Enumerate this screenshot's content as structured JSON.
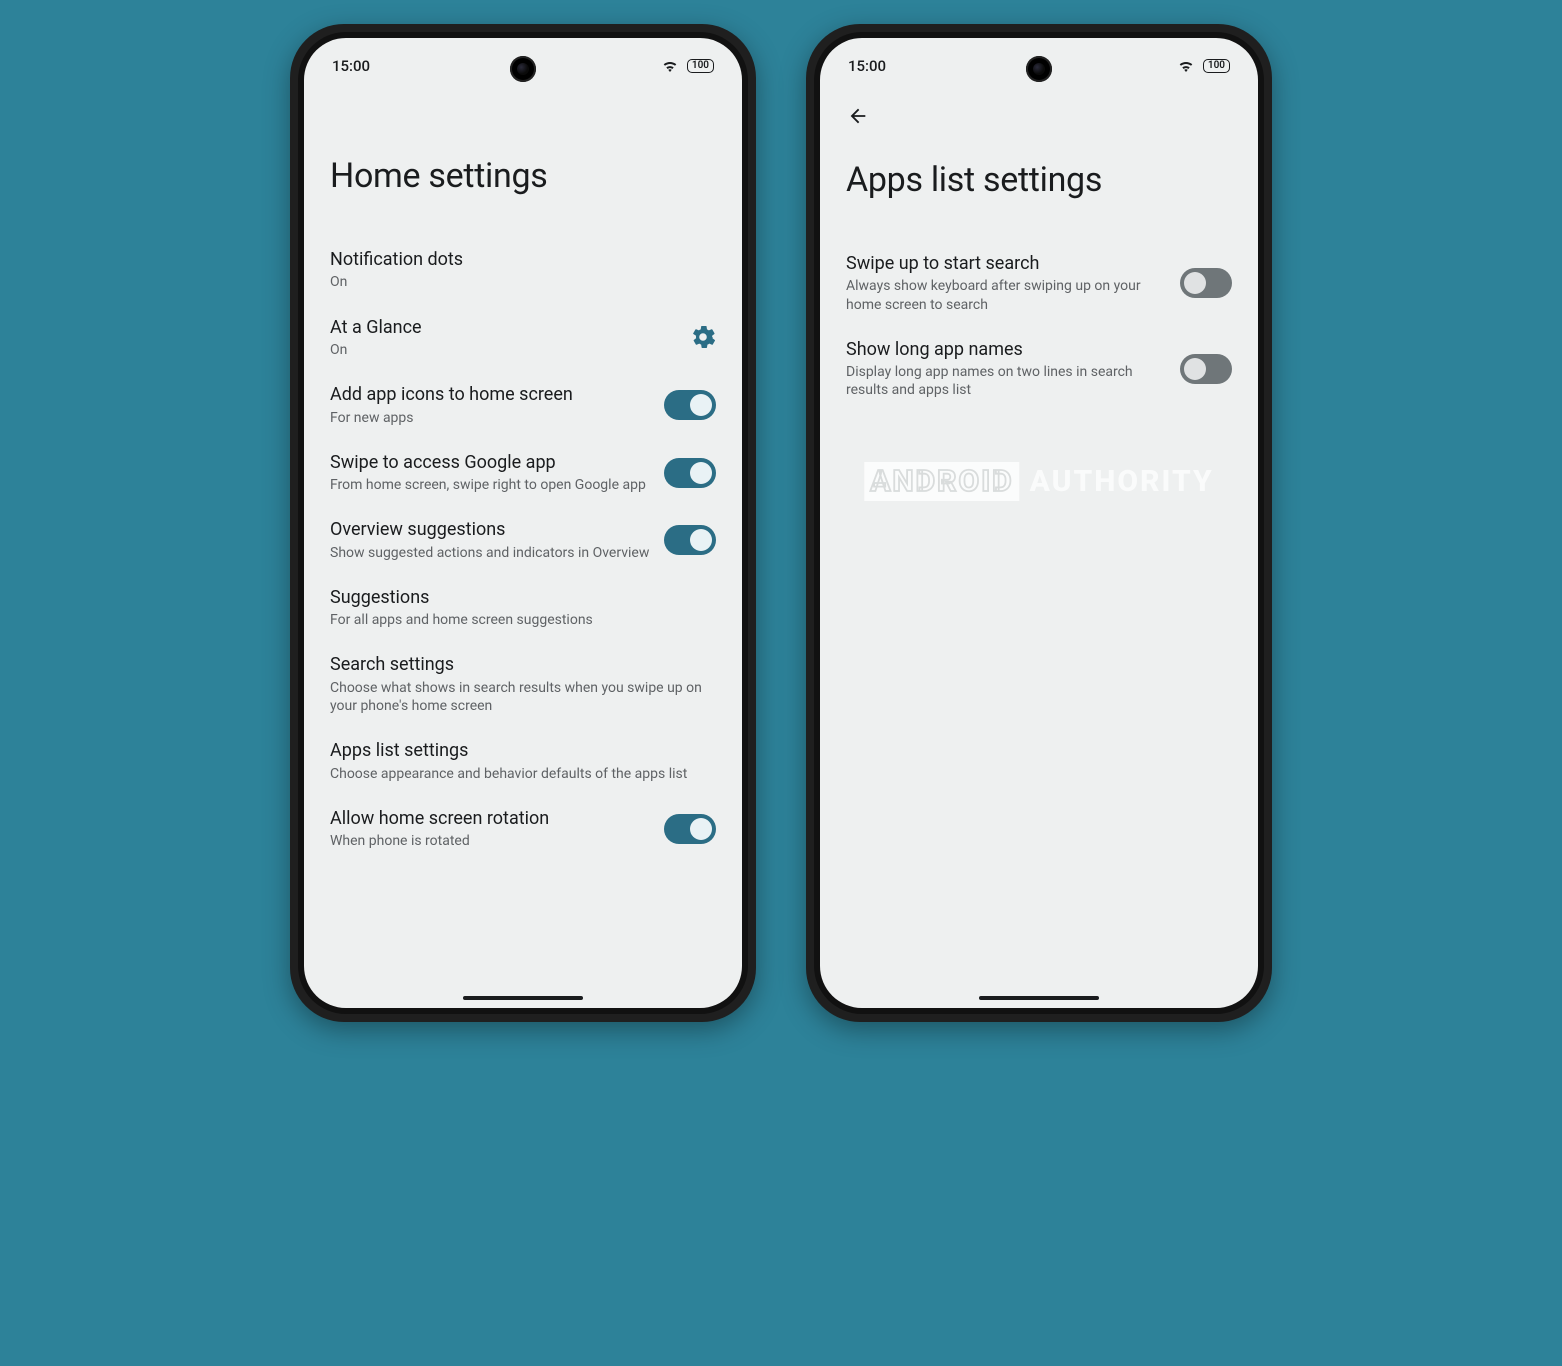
{
  "status": {
    "time": "15:00",
    "battery": "100"
  },
  "left": {
    "title": "Home settings",
    "items": [
      {
        "title": "Notification dots",
        "sub": "On",
        "control": "none"
      },
      {
        "title": "At a Glance",
        "sub": "On",
        "control": "gear"
      },
      {
        "title": "Add app icons to home screen",
        "sub": "For new apps",
        "control": "toggle_on"
      },
      {
        "title": "Swipe to access Google app",
        "sub": "From home screen, swipe right to open Google app",
        "control": "toggle_on"
      },
      {
        "title": "Overview suggestions",
        "sub": "Show suggested actions and indicators in Overview",
        "control": "toggle_on"
      },
      {
        "title": "Suggestions",
        "sub": "For all apps and home screen suggestions",
        "control": "none"
      },
      {
        "title": "Search settings",
        "sub": "Choose what shows in search results when you swipe up on your phone's home screen",
        "control": "none"
      },
      {
        "title": "Apps list settings",
        "sub": "Choose appearance and behavior defaults of the apps list",
        "control": "none"
      },
      {
        "title": "Allow home screen rotation",
        "sub": "When phone is rotated",
        "control": "toggle_on"
      }
    ]
  },
  "right": {
    "title": "Apps list settings",
    "items": [
      {
        "title": "Swipe up to start search",
        "sub": "Always show keyboard after swiping up on your home screen to search",
        "control": "toggle_off"
      },
      {
        "title": "Show long app names",
        "sub": "Display long app names on two lines in search results and apps list",
        "control": "toggle_off"
      }
    ]
  },
  "watermark": {
    "a": "ANDROID",
    "b": "AUTHORITY"
  }
}
